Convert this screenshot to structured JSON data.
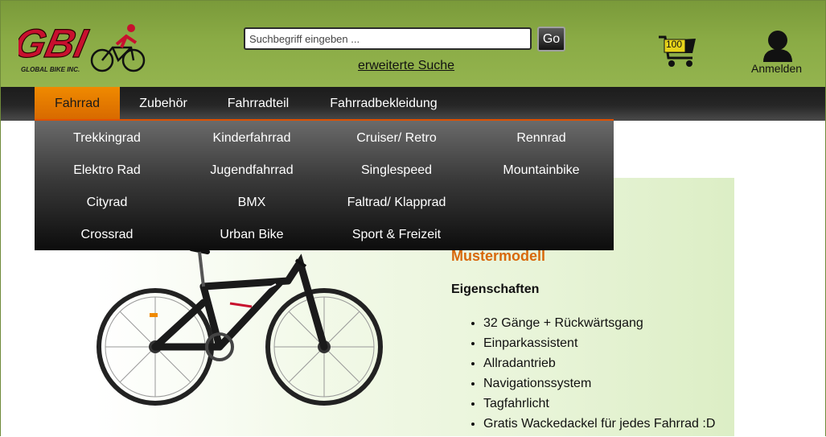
{
  "header": {
    "logo_text": "GBI",
    "logo_subtext": "GLOBAL BIKE INC.",
    "search_placeholder": "Suchbegriff eingeben ...",
    "search_button": "Go",
    "advanced_search": "erweiterte Suche",
    "cart_count": "100",
    "login_label": "Anmelden"
  },
  "nav": {
    "items": [
      "Fahrrad",
      "Zubehör",
      "Fahrradteil",
      "Fahrradbekleidung"
    ],
    "active": "Fahrrad"
  },
  "dropdown": {
    "columns": [
      [
        "Trekkingrad",
        "Elektro Rad",
        "Cityrad",
        "Crossrad"
      ],
      [
        "Kinderfahrrad",
        "Jugendfahrrad",
        "BMX",
        "Urban Bike"
      ],
      [
        "Cruiser/ Retro",
        "Singlespeed",
        "Faltrad/ Klapprad",
        "Sport & Freizeit"
      ],
      [
        "Rennrad",
        "Mountainbike"
      ]
    ]
  },
  "product": {
    "model": "Mustermodell",
    "properties_title": "Eigenschaften",
    "properties": [
      "32 Gänge + Rückwärtsgang",
      "Einparkassistent",
      "Allradantrieb",
      "Navigationssystem",
      "Tagfahrlicht",
      "Gratis Wackedackel für jedes Fahrrad :D"
    ]
  },
  "colors": {
    "header_green": "#8aab45",
    "active_orange": "#f08a00",
    "logo_red": "#c8102e",
    "title_orange": "#d8680c"
  }
}
